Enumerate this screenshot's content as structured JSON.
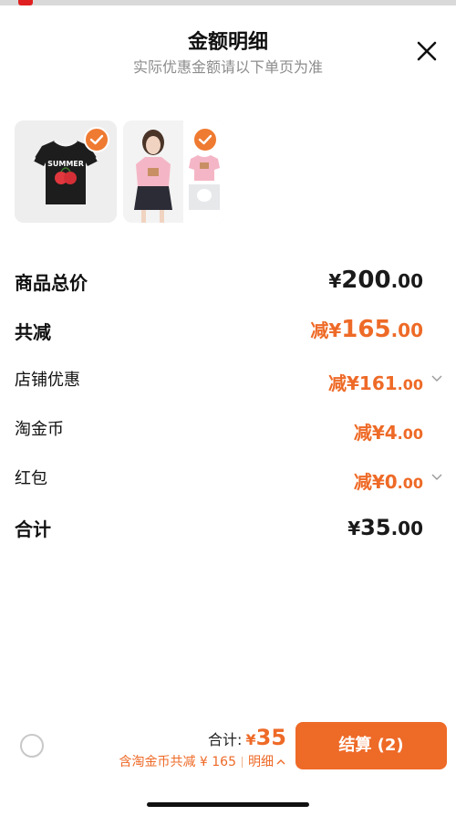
{
  "header": {
    "title": "金额明细",
    "subtitle": "实际优惠金额请以下单页为准"
  },
  "thumbnails": [
    {
      "name": "black-tshirt",
      "selected": true,
      "print_text": "SUMMER"
    },
    {
      "name": "pink-tshirt-set",
      "selected": true
    }
  ],
  "breakdown": {
    "goods_total": {
      "label": "商品总价",
      "currency": "¥",
      "int": "200",
      "dec": ".00"
    },
    "total_reduce": {
      "label": "共减",
      "prefix": "减",
      "currency": "¥",
      "int": "165",
      "dec": ".00"
    },
    "shop_discount": {
      "label": "店铺优惠",
      "prefix": "减",
      "currency": "¥",
      "int": "161",
      "dec": ".00"
    },
    "coins": {
      "label": "淘金币",
      "prefix": "减",
      "currency": "¥",
      "int": "4",
      "dec": ".00"
    },
    "red_packet": {
      "label": "红包",
      "prefix": "减",
      "currency": "¥",
      "int": "0",
      "dec": ".00"
    },
    "grand_total": {
      "label": "合计",
      "currency": "¥",
      "int": "35",
      "dec": ".00"
    }
  },
  "bottom": {
    "total_label": "合计:",
    "total_currency": "¥",
    "total_amount": "35",
    "saving_text": "含淘金币共减 ¥ 165",
    "detail_link": "明细",
    "settle_label": "结算 (2)"
  },
  "colors": {
    "accent": "#ee6a27",
    "muted": "#8c8c8c"
  }
}
